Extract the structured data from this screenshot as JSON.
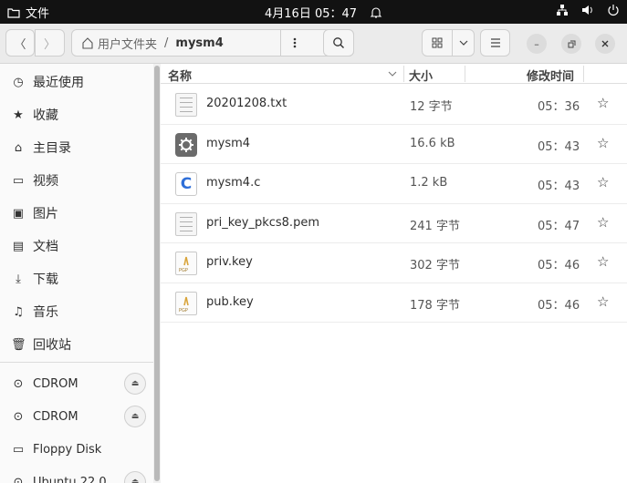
{
  "topbar": {
    "app_name": "文件",
    "datetime": "4月16日 05：47"
  },
  "header": {
    "back_label": "〈",
    "forward_label": "〉",
    "path_home": "用户文件夹",
    "path_sep": "/",
    "path_current": "mysm4"
  },
  "sidebar": {
    "items": [
      {
        "label": "最近使用",
        "icon": "clock-icon"
      },
      {
        "label": "收藏",
        "icon": "star-icon"
      },
      {
        "label": "主目录",
        "icon": "home-icon"
      },
      {
        "label": "视频",
        "icon": "video-icon"
      },
      {
        "label": "图片",
        "icon": "image-icon"
      },
      {
        "label": "文档",
        "icon": "document-icon"
      },
      {
        "label": "下载",
        "icon": "download-icon"
      },
      {
        "label": "音乐",
        "icon": "music-icon"
      },
      {
        "label": "回收站",
        "icon": "trash-icon"
      }
    ],
    "devices": [
      {
        "label": "CDROM",
        "icon": "disc-icon",
        "eject": true
      },
      {
        "label": "CDROM",
        "icon": "disc-icon",
        "eject": true
      },
      {
        "label": "Floppy Disk",
        "icon": "drive-icon",
        "eject": false
      },
      {
        "label": "Ubuntu 22.0",
        "icon": "disc-icon",
        "eject": true
      }
    ]
  },
  "columns": {
    "name": "名称",
    "size": "大小",
    "modified": "修改时间"
  },
  "files": [
    {
      "name": "20201208.txt",
      "size": "12 字节",
      "time": "05：36",
      "type": "text"
    },
    {
      "name": "mysm4",
      "size": "16.6 kB",
      "time": "05：43",
      "type": "executable"
    },
    {
      "name": "mysm4.c",
      "size": "1.2 kB",
      "time": "05：43",
      "type": "c-source"
    },
    {
      "name": "pri_key_pkcs8.pem",
      "size": "241 字节",
      "time": "05：47",
      "type": "text"
    },
    {
      "name": "priv.key",
      "size": "302 字节",
      "time": "05：46",
      "type": "key"
    },
    {
      "name": "pub.key",
      "size": "178 字节",
      "time": "05：46",
      "type": "key"
    }
  ]
}
